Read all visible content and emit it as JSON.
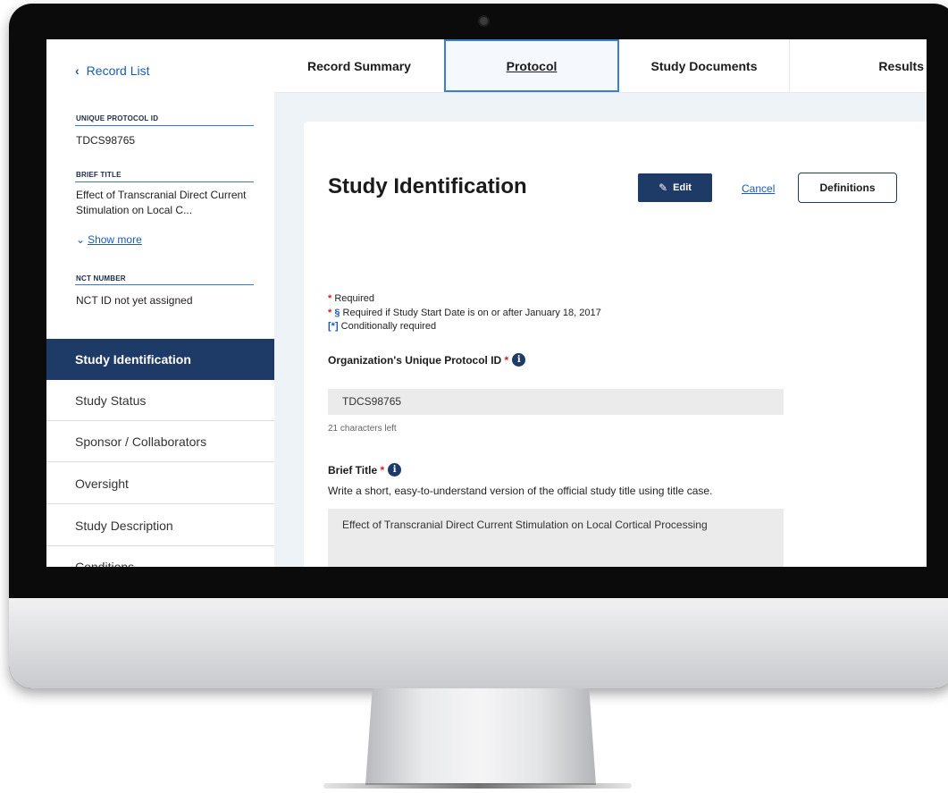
{
  "sidebar": {
    "back_label": "Record List",
    "unique_protocol_id_label": "UNIQUE PROTOCOL ID",
    "unique_protocol_id_value": "TDCS98765",
    "brief_title_label": "BRIEF TITLE",
    "brief_title_value": "Effect of Transcranial Direct Current Stimulation on Local C...",
    "show_more": "Show more",
    "nct_number_label": "NCT NUMBER",
    "nct_number_value": "NCT ID not yet assigned",
    "nav": [
      {
        "label": "Study Identification",
        "active": true
      },
      {
        "label": "Study Status",
        "active": false
      },
      {
        "label": "Sponsor / Collaborators",
        "active": false
      },
      {
        "label": "Oversight",
        "active": false
      },
      {
        "label": "Study Description",
        "active": false
      },
      {
        "label": "Conditions",
        "active": false
      }
    ]
  },
  "tabs": [
    {
      "label": "Record Summary",
      "active": false
    },
    {
      "label": "Protocol",
      "active": true
    },
    {
      "label": "Study Documents",
      "active": false
    },
    {
      "label": "Results",
      "active": false
    }
  ],
  "main": {
    "title": "Study Identification",
    "edit_label": "Edit",
    "cancel_label": "Cancel",
    "definitions_label": "Definitions",
    "legend": {
      "required": "Required",
      "required_symbol": "*",
      "section_symbol": "§",
      "required_if": "Required if Study Start Date is on or after January 18, 2017",
      "conditional_symbol": "[*]",
      "conditional": "Conditionally required"
    },
    "org_protocol_id": {
      "label": "Organization's Unique Protocol ID",
      "value": "TDCS98765",
      "hint": "21 characters left"
    },
    "brief_title": {
      "label": "Brief Title",
      "help": "Write a short, easy-to-understand version of the official study title using title case.",
      "value": "Effect of Transcranial Direct Current Stimulation on Local Cortical Processing"
    }
  },
  "colors": {
    "accent_navy": "#1e3a66",
    "link_blue": "#1a5bb8",
    "required_red": "#d21f1f"
  }
}
